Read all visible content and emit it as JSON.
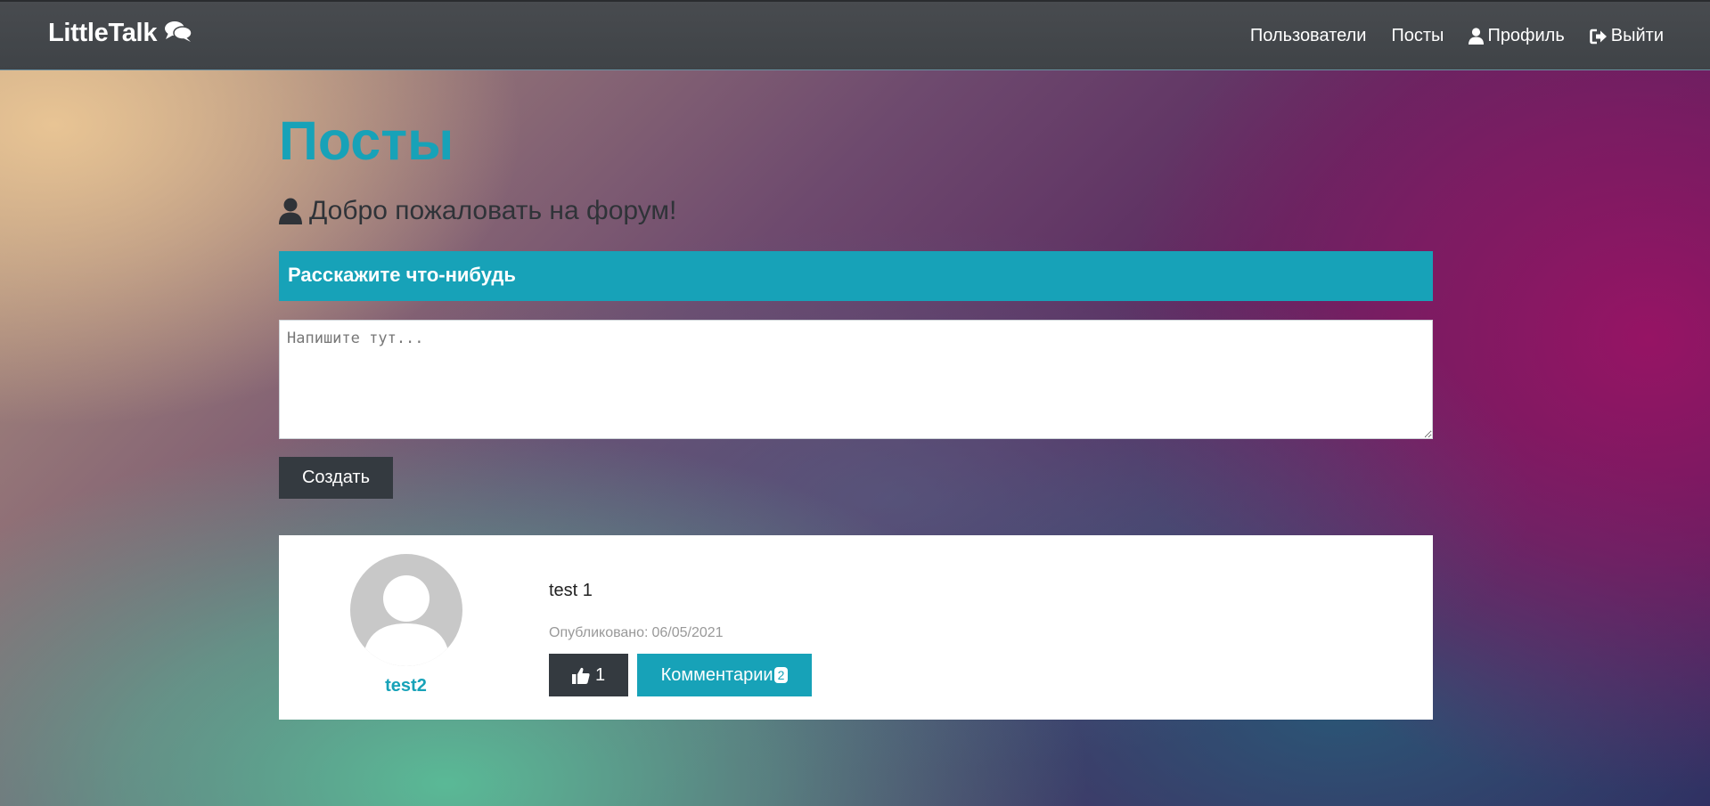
{
  "navbar": {
    "brand": "LittleTalk",
    "brand_icon": "comments-icon",
    "links": [
      {
        "label": "Пользователи"
      },
      {
        "label": "Посты"
      },
      {
        "label": "Профиль",
        "icon": "user-icon"
      },
      {
        "label": "Выйти",
        "icon": "sign-out-icon"
      }
    ]
  },
  "page": {
    "title": "Посты",
    "welcome": "Добро пожаловать на форум!"
  },
  "form": {
    "header": "Расскажите что-нибудь",
    "placeholder": "Напишите тут...",
    "submit_label": "Создать"
  },
  "posts": [
    {
      "author": "test2",
      "text": "test 1",
      "published_label": "Опубликовано:",
      "published_date": "06/05/2021",
      "likes": "1",
      "comments_label": "Комментарии",
      "comments_count": "2"
    }
  ],
  "colors": {
    "accent": "#17a2b8",
    "dark": "#343a40"
  }
}
